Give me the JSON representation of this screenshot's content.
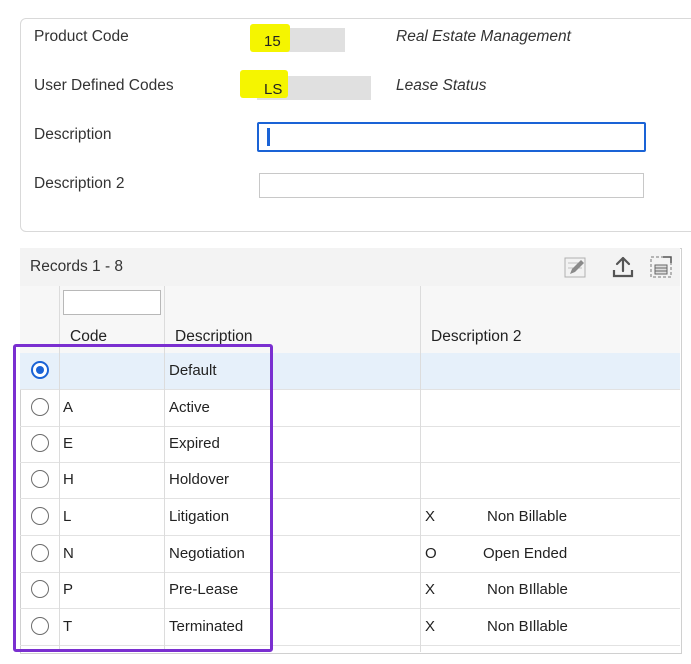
{
  "form": {
    "product_code": {
      "label": "Product Code",
      "value": "15",
      "description": "Real Estate Management"
    },
    "user_defined_codes": {
      "label": "User Defined Codes",
      "value": "LS",
      "description": "Lease Status"
    },
    "description": {
      "label": "Description",
      "value": ""
    },
    "description2": {
      "label": "Description 2",
      "value": ""
    }
  },
  "grid": {
    "records_label": "Records 1 - 8",
    "filter_value": "",
    "columns": {
      "code": "Code",
      "description": "Description",
      "description2": "Description 2"
    },
    "rows": [
      {
        "code": "",
        "description": "Default",
        "d2_code": "",
        "d2_text": "",
        "selected": true
      },
      {
        "code": "A",
        "description": "Active",
        "d2_code": "",
        "d2_text": "",
        "selected": false
      },
      {
        "code": "E",
        "description": "Expired",
        "d2_code": "",
        "d2_text": "",
        "selected": false
      },
      {
        "code": "H",
        "description": "Holdover",
        "d2_code": "",
        "d2_text": "",
        "selected": false
      },
      {
        "code": "L",
        "description": "Litigation",
        "d2_code": "X",
        "d2_text": "Non Billable",
        "selected": false
      },
      {
        "code": "N",
        "description": "Negotiation",
        "d2_code": "O",
        "d2_text": "Open Ended",
        "selected": false
      },
      {
        "code": "P",
        "description": "Pre-Lease",
        "d2_code": "X",
        "d2_text": "Non BIllable",
        "selected": false
      },
      {
        "code": "T",
        "description": "Terminated",
        "d2_code": "X",
        "d2_text": "Non BIllable",
        "selected": false
      }
    ]
  },
  "icons": [
    "edit-icon",
    "export-icon",
    "expand-grid-icon"
  ],
  "colors": {
    "highlight": "#f5f500",
    "focus_blue": "#1a63d6",
    "annotation_purple": "#7a2fd0",
    "selected_row": "#e6f0fa"
  }
}
